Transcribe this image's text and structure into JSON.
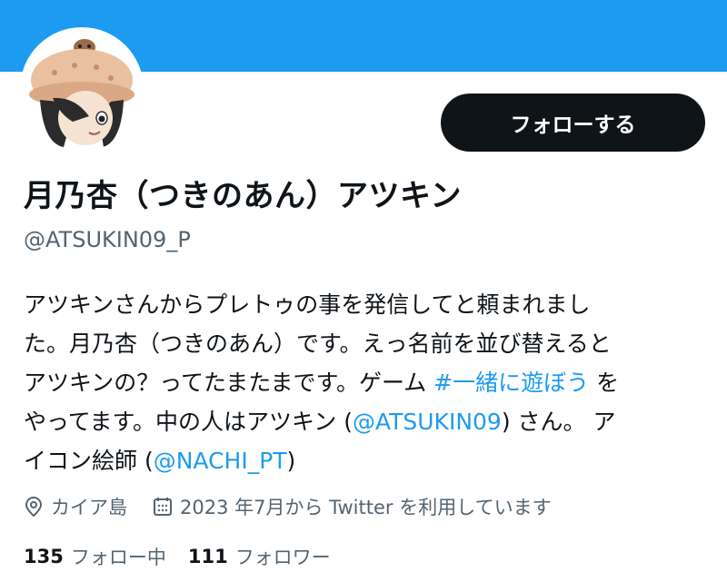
{
  "profile": {
    "display_name": "月乃杏（つきのあん）アツキン",
    "handle": "@ATSUKIN09_P",
    "follow_button": "フォローする",
    "bio": {
      "line1": "アツキンさんからプレトゥの事を発信してと頼まれまし",
      "line2": "た。月乃杏（つきのあん）です。えっ名前を並び替えると",
      "line3_a": "アツキンの？ってたまたまです。ゲーム ",
      "line3_hashtag": "#一緒に遊ぼう",
      "line3_b": " を",
      "line4_a": "やってます。中の人はアツキン (",
      "line4_mention": "@ATSUKIN09",
      "line4_b": ") さん。 ア",
      "line5_a": "イコン絵師 (",
      "line5_mention": "@NACHI_PT",
      "line5_b": ")"
    },
    "location": "カイア島",
    "joined": "2023 年7月から Twitter を利用しています",
    "following_count": "135",
    "following_label": "フォロー中",
    "followers_count": "111",
    "followers_label": "フォロワー"
  },
  "icons": {
    "location": "location-pin-icon",
    "joined": "calendar-icon"
  },
  "colors": {
    "banner": "#1d9bf0",
    "link": "#1d9bf0",
    "text": "#0f1419",
    "secondary": "#536471",
    "button_bg": "#0f1419"
  }
}
